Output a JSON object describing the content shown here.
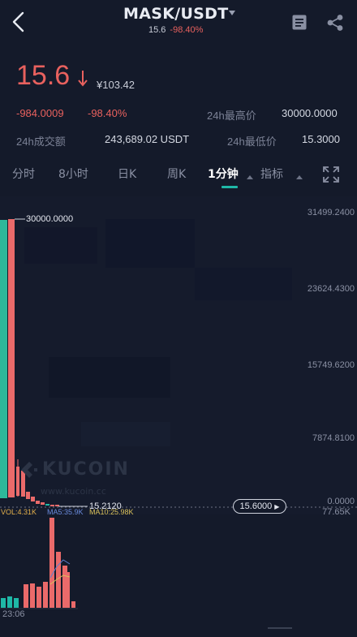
{
  "header": {
    "pair": "MASK/USDT",
    "sub_price": "15.6",
    "sub_change": "-98.40%"
  },
  "ticker": {
    "last_price": "15.6",
    "cny_price": "¥103.42",
    "change_abs": "-984.0009",
    "change_pct": "-98.40%",
    "high_label": "24h最高价",
    "high_value": "30000.0000",
    "volume_label": "24h成交额",
    "volume_value": "243,689.02 USDT",
    "low_label": "24h最低价",
    "low_value": "15.3000",
    "accent_down": "#e8615e",
    "accent_up": "#1fb8a7"
  },
  "tabs": [
    {
      "label": "分时",
      "active": false
    },
    {
      "label": "8小时",
      "active": false
    },
    {
      "label": "日K",
      "active": false
    },
    {
      "label": "周K",
      "active": false
    },
    {
      "label": "1分钟",
      "active": true
    },
    {
      "label": "指标",
      "active": false
    }
  ],
  "chart": {
    "price_axis": [
      "31499.2400",
      "23624.4300",
      "15749.6200",
      "7874.8100",
      "0.0000"
    ],
    "high_marker": "30000.0000",
    "low_marker": "15.2120",
    "current_price": "15.6000",
    "watermark": "KUCOIN",
    "watermark_url": "www.kucoin.cc",
    "vol_label": "VOL:4.31K",
    "ma5_label": "MA5:35.9K",
    "ma10_label": "MA10:25.98K",
    "vol_axis_max": "77.65K",
    "time_label": "23:06"
  }
}
